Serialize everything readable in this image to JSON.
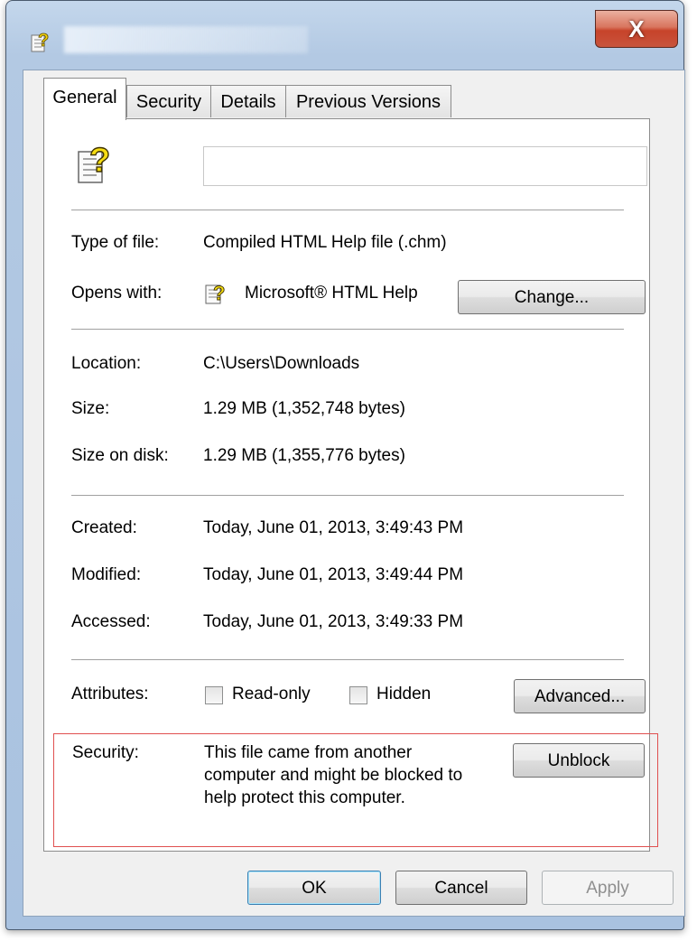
{
  "window": {
    "close_glyph": "X",
    "title_icon": "unknown-file-icon"
  },
  "tabs": [
    {
      "label": "General",
      "active": true
    },
    {
      "label": "Security",
      "active": false
    },
    {
      "label": "Details",
      "active": false
    },
    {
      "label": "Previous Versions",
      "active": false
    }
  ],
  "file": {
    "icon": "unknown-file-icon",
    "name_value": ""
  },
  "info": {
    "type_label": "Type of file:",
    "type_value": "Compiled HTML Help file (.chm)",
    "opens_label": "Opens with:",
    "opens_value": "Microsoft® HTML Help",
    "opens_icon": "html-help-icon",
    "change_button": "Change...",
    "location_label": "Location:",
    "location_value": "C:\\Users\\Downloads",
    "size_label": "Size:",
    "size_value": "1.29 MB (1,352,748 bytes)",
    "size_on_disk_label": "Size on disk:",
    "size_on_disk_value": "1.29 MB (1,355,776 bytes)",
    "created_label": "Created:",
    "created_value": "Today, June 01, 2013, 3:49:43 PM",
    "modified_label": "Modified:",
    "modified_value": "Today, June 01, 2013, 3:49:44 PM",
    "accessed_label": "Accessed:",
    "accessed_value": "Today, June 01, 2013, 3:49:33 PM",
    "attributes_label": "Attributes:",
    "readonly_label": "Read-only",
    "readonly_checked": false,
    "hidden_label": "Hidden",
    "hidden_checked": false,
    "advanced_button": "Advanced...",
    "security_label": "Security:",
    "security_lines": [
      "This file came from another",
      "computer and might be blocked to",
      "help protect this computer."
    ],
    "unblock_button": "Unblock"
  },
  "footer": {
    "ok": "OK",
    "cancel": "Cancel",
    "apply": "Apply"
  },
  "colors": {
    "highlight_border": "#e05050",
    "close_button": "#c7432a"
  }
}
